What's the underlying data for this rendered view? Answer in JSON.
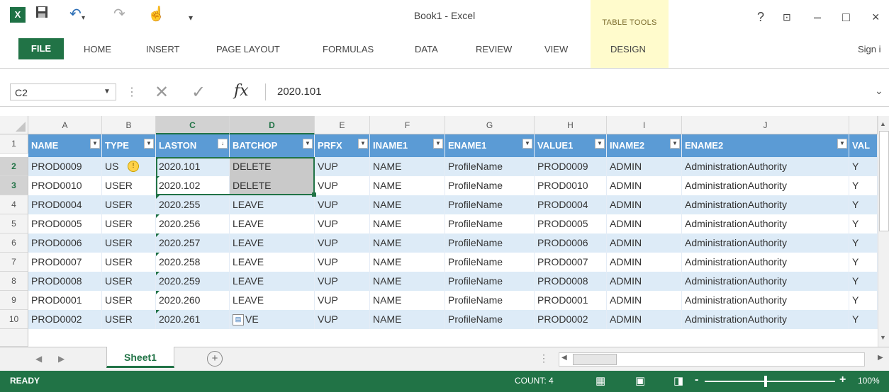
{
  "window": {
    "title": "Book1 - Excel",
    "table_tools": "TABLE TOOLS",
    "help": "?",
    "minimize": "–",
    "maximize": "□",
    "close": "×"
  },
  "ribbon": {
    "tabs": [
      "FILE",
      "HOME",
      "INSERT",
      "PAGE LAYOUT",
      "FORMULAS",
      "DATA",
      "REVIEW",
      "VIEW",
      "DESIGN"
    ],
    "sign_in": "Sign i"
  },
  "formula_bar": {
    "name_box": "C2",
    "fx": "fx",
    "value": "2020.101"
  },
  "columns": [
    "A",
    "B",
    "C",
    "D",
    "E",
    "F",
    "G",
    "H",
    "I",
    "J"
  ],
  "table": {
    "headers": [
      "NAME",
      "TYPE",
      "LASTON",
      "BATCHOP",
      "PRFX",
      "INAME1",
      "ENAME1",
      "VALUE1",
      "INAME2",
      "ENAME2",
      "VAL"
    ],
    "rows": [
      [
        "PROD0009",
        "US",
        "2020.101",
        "DELETE",
        "VUP",
        "NAME",
        "ProfileName",
        "PROD0009",
        "ADMIN",
        "AdministrationAuthority",
        "Y"
      ],
      [
        "PROD0010",
        "USER",
        "2020.102",
        "DELETE",
        "VUP",
        "NAME",
        "ProfileName",
        "PROD0010",
        "ADMIN",
        "AdministrationAuthority",
        "Y"
      ],
      [
        "PROD0004",
        "USER",
        "2020.255",
        "LEAVE",
        "VUP",
        "NAME",
        "ProfileName",
        "PROD0004",
        "ADMIN",
        "AdministrationAuthority",
        "Y"
      ],
      [
        "PROD0005",
        "USER",
        "2020.256",
        "LEAVE",
        "VUP",
        "NAME",
        "ProfileName",
        "PROD0005",
        "ADMIN",
        "AdministrationAuthority",
        "Y"
      ],
      [
        "PROD0006",
        "USER",
        "2020.257",
        "LEAVE",
        "VUP",
        "NAME",
        "ProfileName",
        "PROD0006",
        "ADMIN",
        "AdministrationAuthority",
        "Y"
      ],
      [
        "PROD0007",
        "USER",
        "2020.258",
        "LEAVE",
        "VUP",
        "NAME",
        "ProfileName",
        "PROD0007",
        "ADMIN",
        "AdministrationAuthority",
        "Y"
      ],
      [
        "PROD0008",
        "USER",
        "2020.259",
        "LEAVE",
        "VUP",
        "NAME",
        "ProfileName",
        "PROD0008",
        "ADMIN",
        "AdministrationAuthority",
        "Y"
      ],
      [
        "PROD0001",
        "USER",
        "2020.260",
        "LEAVE",
        "VUP",
        "NAME",
        "ProfileName",
        "PROD0001",
        "ADMIN",
        "AdministrationAuthority",
        "Y"
      ],
      [
        "PROD0002",
        "USER",
        "2020.261",
        "VE",
        "VUP",
        "NAME",
        "ProfileName",
        "PROD0002",
        "ADMIN",
        "AdministrationAuthority",
        "Y"
      ]
    ]
  },
  "sheets": {
    "active": "Sheet1",
    "add": "+"
  },
  "status": {
    "ready": "READY",
    "count": "COUNT: 4",
    "zoom": "100%",
    "zoom_minus": "-",
    "zoom_plus": "+"
  },
  "colors": {
    "excel_green": "#217346",
    "table_header": "#5b9bd5",
    "band": "#ddebf7",
    "table_tools_bg": "#fffbcc"
  }
}
